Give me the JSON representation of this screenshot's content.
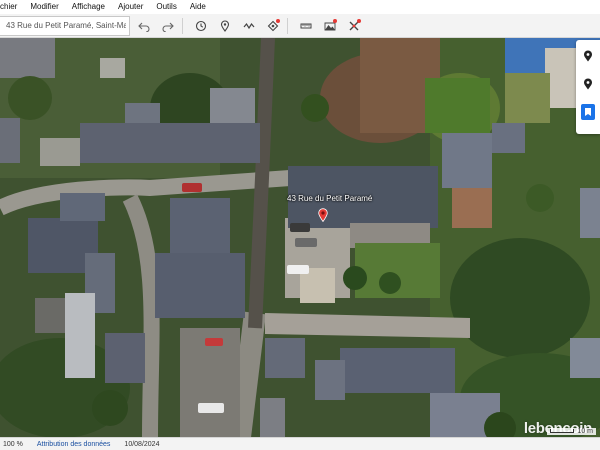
{
  "menu": [
    "chier",
    "Modifier",
    "Affichage",
    "Ajouter",
    "Outils",
    "Aide"
  ],
  "search": {
    "value": "43 Rue du Petit Paramé, Saint-Ma"
  },
  "toolbar_icons": [
    "undo-icon",
    "redo-icon",
    "history-icon",
    "placemark-icon",
    "path-icon",
    "polygon-icon",
    "ruler-icon",
    "image-overlay-icon",
    "tour-icon"
  ],
  "map": {
    "address_label": "43 Rue du Petit Paramé",
    "watermark": "leboncoin",
    "scale_label": "10 m"
  },
  "status": {
    "zoom": "100 %",
    "attribution": "Attribution des données",
    "date": "10/08/2024"
  },
  "colors": {
    "accent": "#1a73e8",
    "pin": "#e53935"
  }
}
